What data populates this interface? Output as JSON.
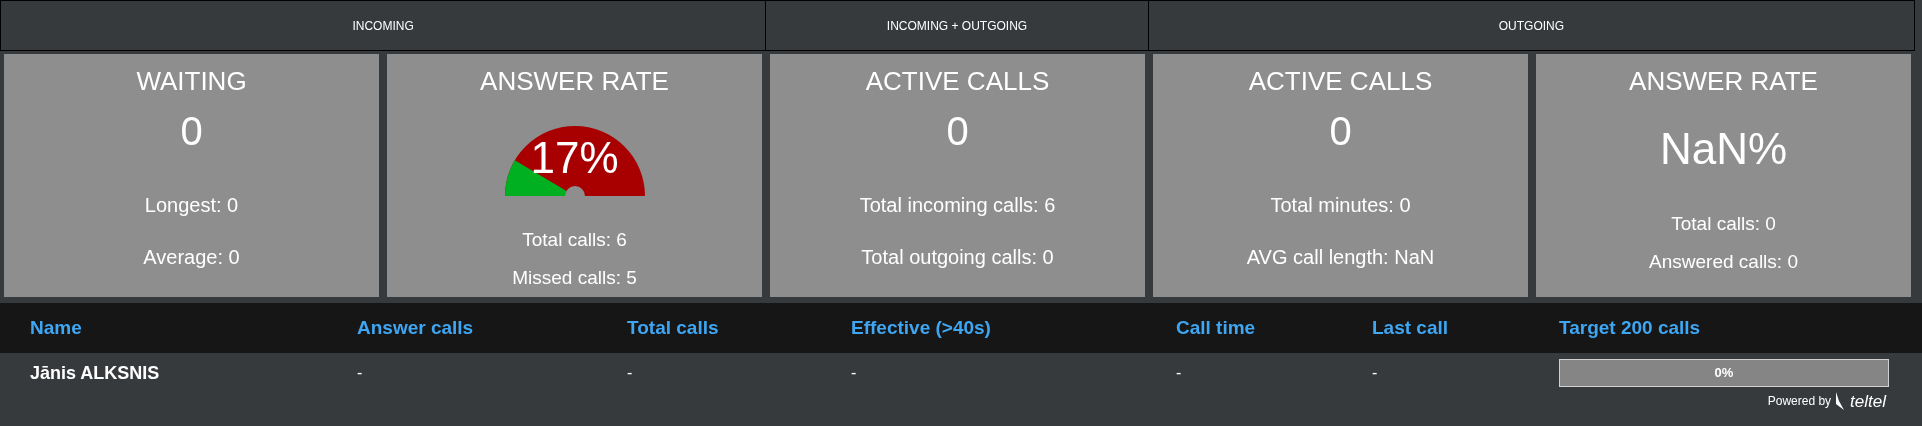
{
  "groups": [
    {
      "label": "INCOMING"
    },
    {
      "label": "INCOMING + OUTGOING"
    },
    {
      "label": "OUTGOING"
    }
  ],
  "cards": [
    {
      "kind": "number",
      "title": "WAITING",
      "value": "0",
      "lines": [
        "Longest: 0",
        "Average: 0"
      ]
    },
    {
      "kind": "gauge",
      "title": "ANSWER RATE",
      "value": "17%",
      "lines": [
        "Total calls: 6",
        "Missed calls: 5"
      ]
    },
    {
      "kind": "number",
      "title": "ACTIVE CALLS",
      "value": "0",
      "lines": [
        "Total incoming calls: 6",
        "Total outgoing calls: 0"
      ]
    },
    {
      "kind": "number",
      "title": "ACTIVE CALLS",
      "value": "0",
      "lines": [
        "Total minutes: 0",
        "AVG call length: NaN"
      ]
    },
    {
      "kind": "percent",
      "title": "ANSWER RATE",
      "value": "NaN%",
      "lines": [
        "Total calls: 0",
        "Answered calls: 0"
      ]
    }
  ],
  "table": {
    "columns": [
      "Name",
      "Answer calls",
      "Total calls",
      "Effective (>40s)",
      "Call time",
      "Last call",
      "Target 200 calls"
    ],
    "rows": [
      {
        "cells": [
          "Jānis ALKSNIS",
          "-",
          "-",
          "-",
          "-",
          "-"
        ],
        "progress": {
          "level": 0,
          "label": "0%"
        }
      }
    ]
  },
  "footer": {
    "text": "Powered by",
    "brand": "teltel"
  }
}
